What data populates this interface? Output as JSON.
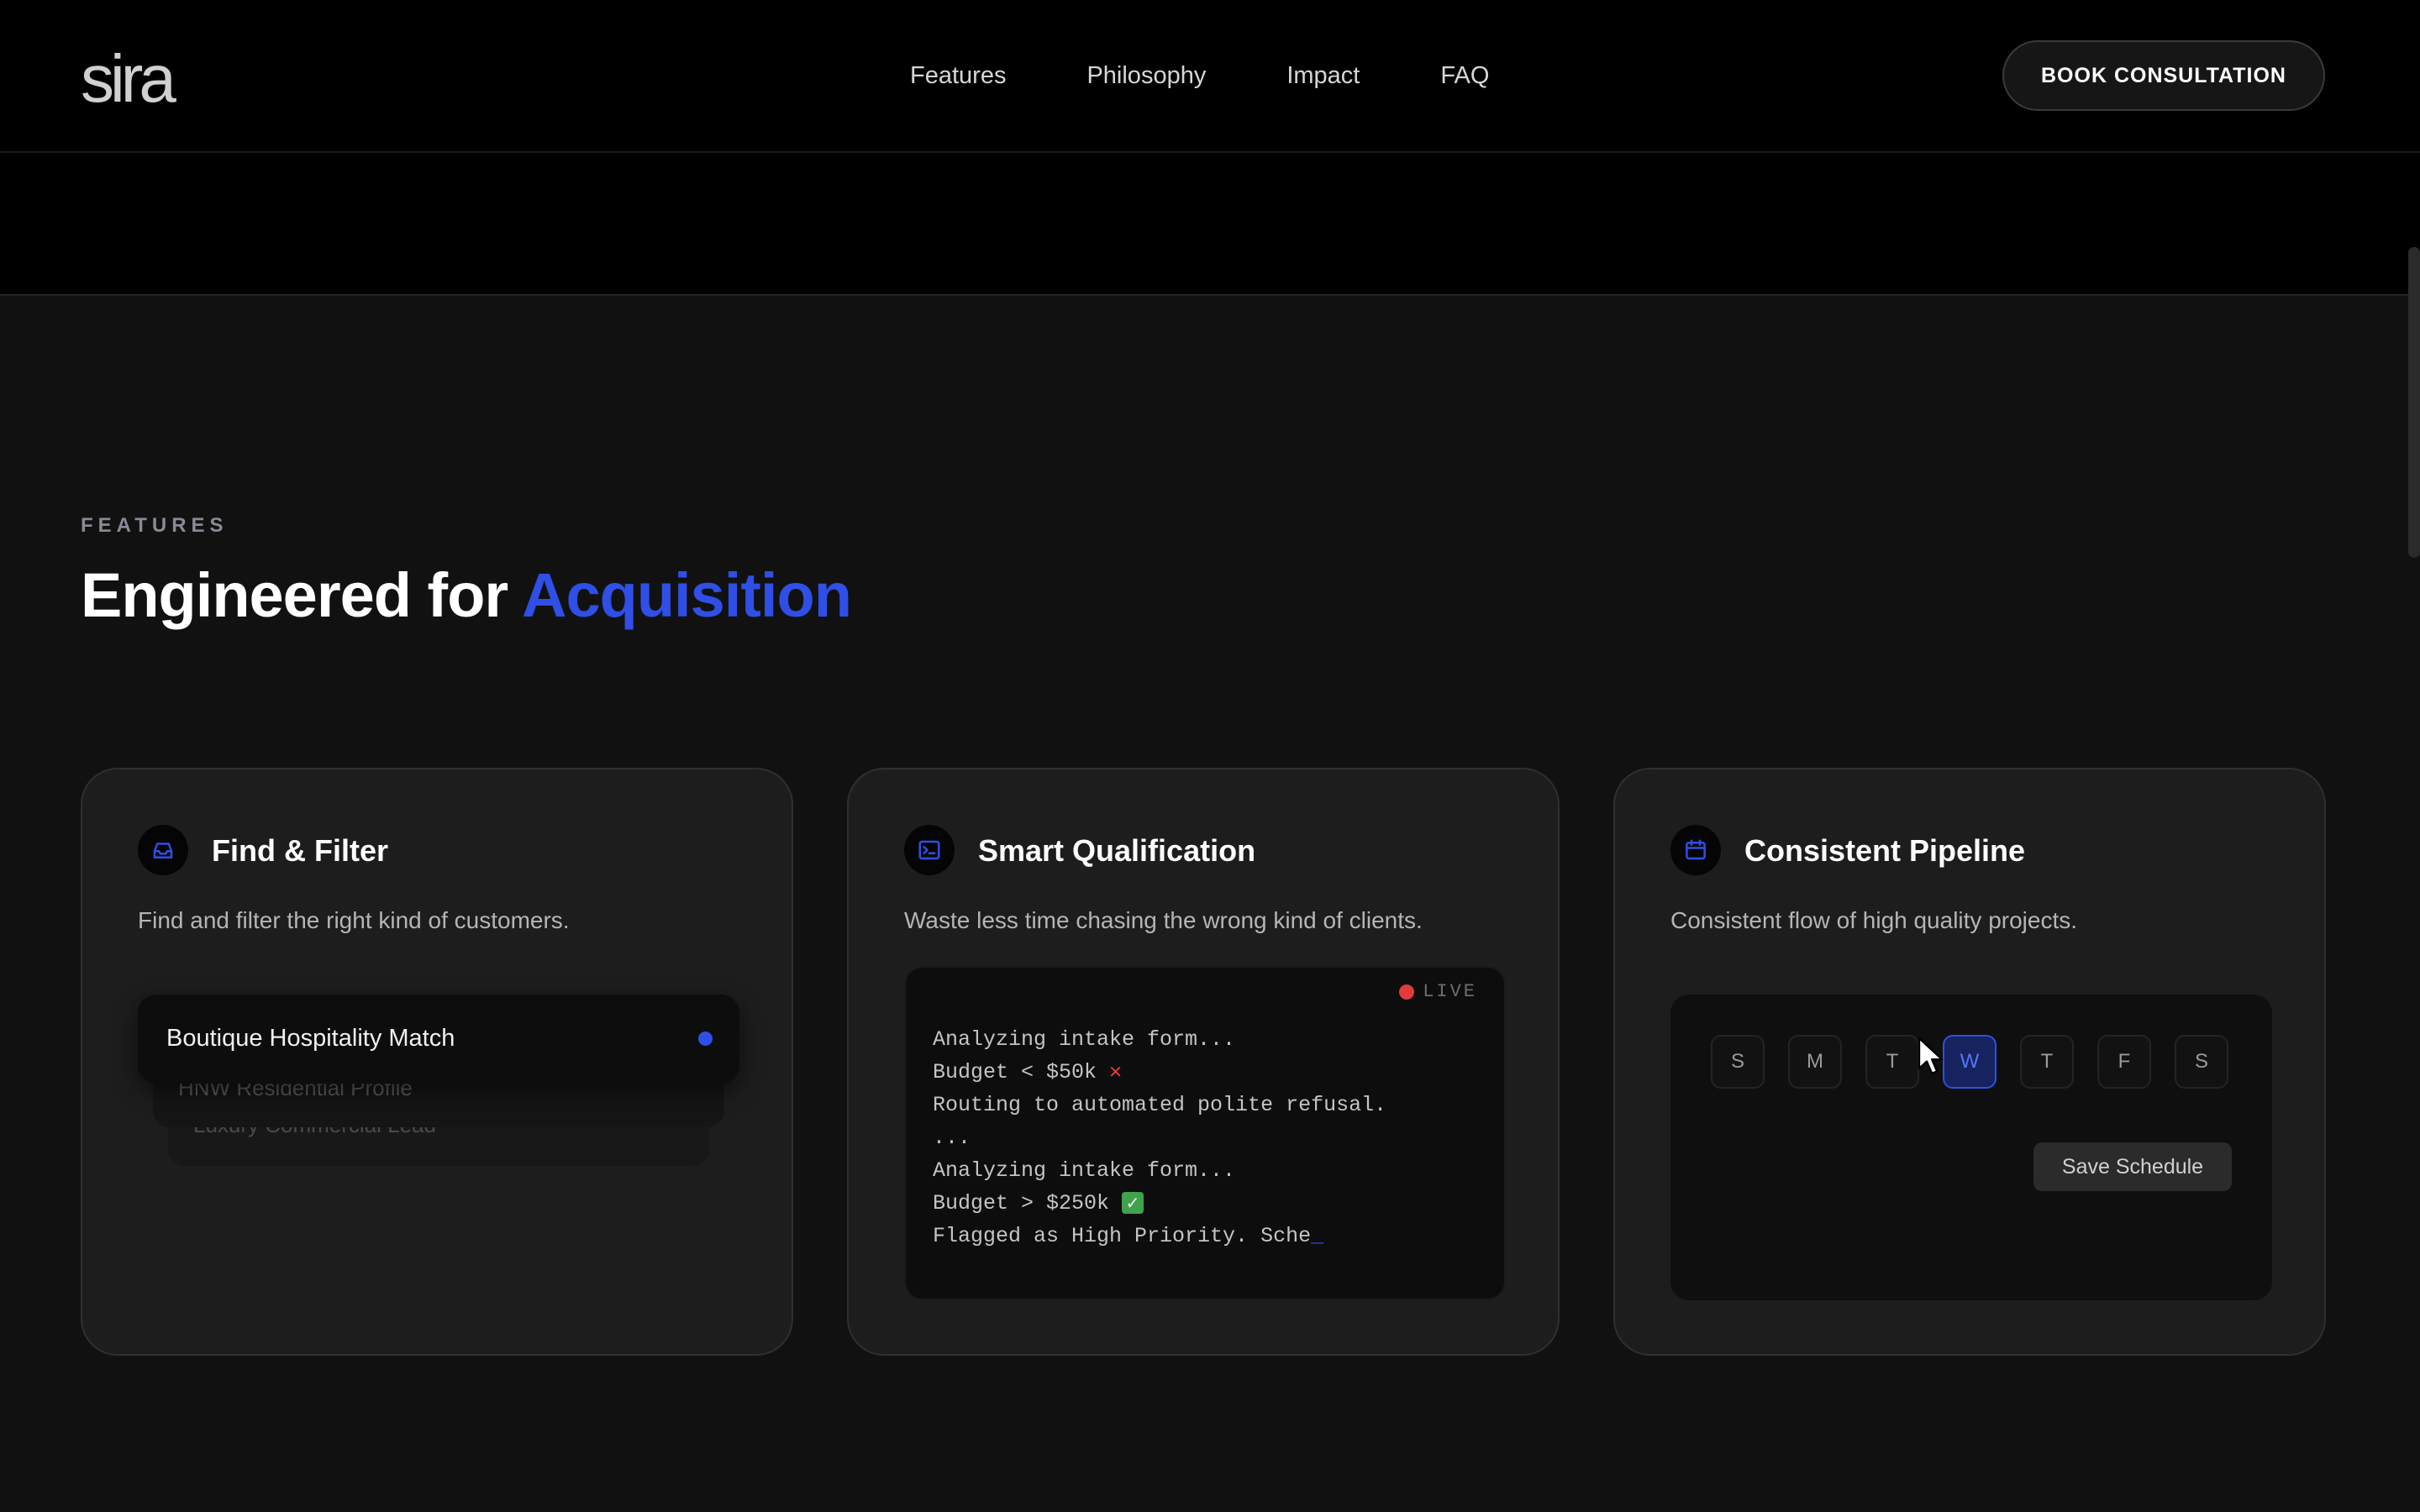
{
  "header": {
    "logo": "sira",
    "nav": [
      "Features",
      "Philosophy",
      "Impact",
      "FAQ"
    ],
    "cta_label": "BOOK CONSULTATION"
  },
  "features": {
    "eyebrow": "FEATURES",
    "headline_prefix": "Engineered for ",
    "headline_accent": "Acquisition",
    "accent_color": "#2f4fe6",
    "cards": [
      {
        "icon": "inbox-icon",
        "title": "Find & Filter",
        "description": "Find and filter the right kind of customers.",
        "stack": [
          "Boutique Hospitality Match",
          "HNW Residential Profile",
          "Luxury Commercial Lead"
        ]
      },
      {
        "icon": "terminal-icon",
        "title": "Smart Qualification",
        "description": "Waste less time chasing the wrong kind of clients.",
        "live_label": "LIVE",
        "lines": [
          "Analyzing intake form...",
          "Budget < $50k ",
          "Routing to automated polite refusal.",
          "...",
          "Analyzing intake form...",
          "Budget > $250k ",
          "Flagged as High Priority. Sche"
        ],
        "cursor": "_"
      },
      {
        "icon": "calendar-icon",
        "title": "Consistent Pipeline",
        "description": "Consistent flow of high quality projects.",
        "days": [
          "S",
          "M",
          "T",
          "W",
          "T",
          "F",
          "S"
        ],
        "selected_day": "W",
        "save_label": "Save Schedule"
      }
    ]
  }
}
